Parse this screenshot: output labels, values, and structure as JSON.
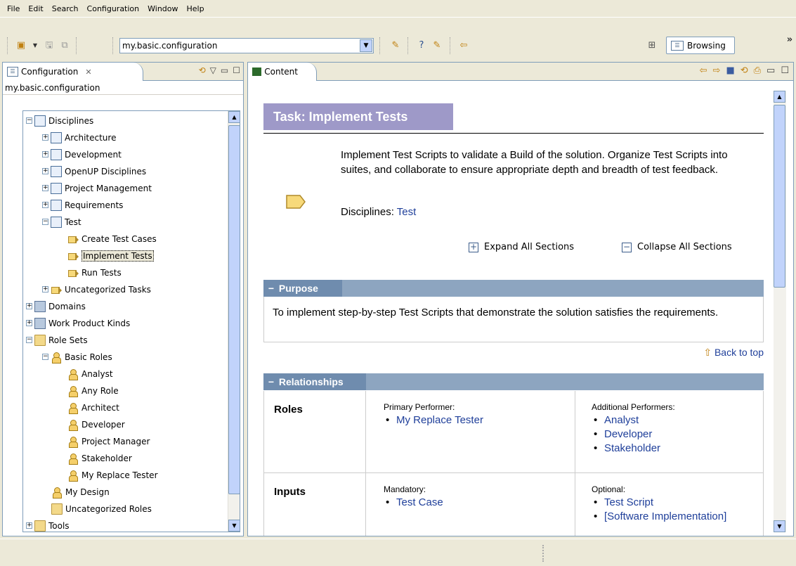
{
  "menu": [
    "File",
    "Edit",
    "Search",
    "Configuration",
    "Window",
    "Help"
  ],
  "toolbar": {
    "config_value": "my.basic.configuration",
    "perspective_label": "Browsing",
    "overflow": "»"
  },
  "left_view": {
    "tab_label": "Configuration",
    "close_glyph": "✕",
    "path": "my.basic.configuration",
    "tree": [
      {
        "label": "Disciplines",
        "expander": "−"
      },
      {
        "label": "Architecture",
        "expander": "+"
      },
      {
        "label": "Development",
        "expander": "+"
      },
      {
        "label": "OpenUP Disciplines",
        "expander": "+"
      },
      {
        "label": "Project Management",
        "expander": "+"
      },
      {
        "label": "Requirements",
        "expander": "+"
      },
      {
        "label": "Test",
        "expander": "−"
      },
      {
        "label": "Create Test Cases"
      },
      {
        "label": "Implement Tests"
      },
      {
        "label": "Run Tests"
      },
      {
        "label": "Uncategorized Tasks",
        "expander": "+"
      },
      {
        "label": "Domains",
        "expander": "+"
      },
      {
        "label": "Work Product Kinds",
        "expander": "+"
      },
      {
        "label": "Role Sets",
        "expander": "−"
      },
      {
        "label": "Basic Roles",
        "expander": "−"
      },
      {
        "label": "Analyst"
      },
      {
        "label": "Any Role"
      },
      {
        "label": "Architect"
      },
      {
        "label": "Developer"
      },
      {
        "label": "Project Manager"
      },
      {
        "label": "Stakeholder"
      },
      {
        "label": "My Replace Tester"
      },
      {
        "label": "My Design"
      },
      {
        "label": "Uncategorized Roles"
      },
      {
        "label": "Tools",
        "expander": "+"
      }
    ]
  },
  "right_view": {
    "tab_label": "Content",
    "title": "Task: Implement Tests",
    "description": "Implement Test Scripts to validate a Build of the solution. Organize Test Scripts into suites, and collaborate to ensure appropriate depth and breadth of test feedback.",
    "disciplines_label": "Disciplines: ",
    "disciplines_link": "Test",
    "expand_all": "Expand All Sections",
    "collapse_all": "Collapse All Sections",
    "purpose_header": "Purpose",
    "purpose_text": "To implement step-by-step Test Scripts that demonstrate the solution satisfies the requirements.",
    "back_to_top": "Back to top",
    "relationships_header": "Relationships",
    "roles_label": "Roles",
    "primary_performer_label": "Primary Performer:",
    "primary_performers": [
      "My Replace Tester"
    ],
    "additional_performers_label": "Additional Performers:",
    "additional_performers": [
      "Analyst",
      "Developer",
      "Stakeholder"
    ],
    "inputs_label": "Inputs",
    "mandatory_label": "Mandatory:",
    "mandatory_inputs": [
      "Test Case"
    ],
    "optional_label": "Optional:",
    "optional_inputs": [
      "Test Script",
      "[Software Implementation]"
    ]
  }
}
